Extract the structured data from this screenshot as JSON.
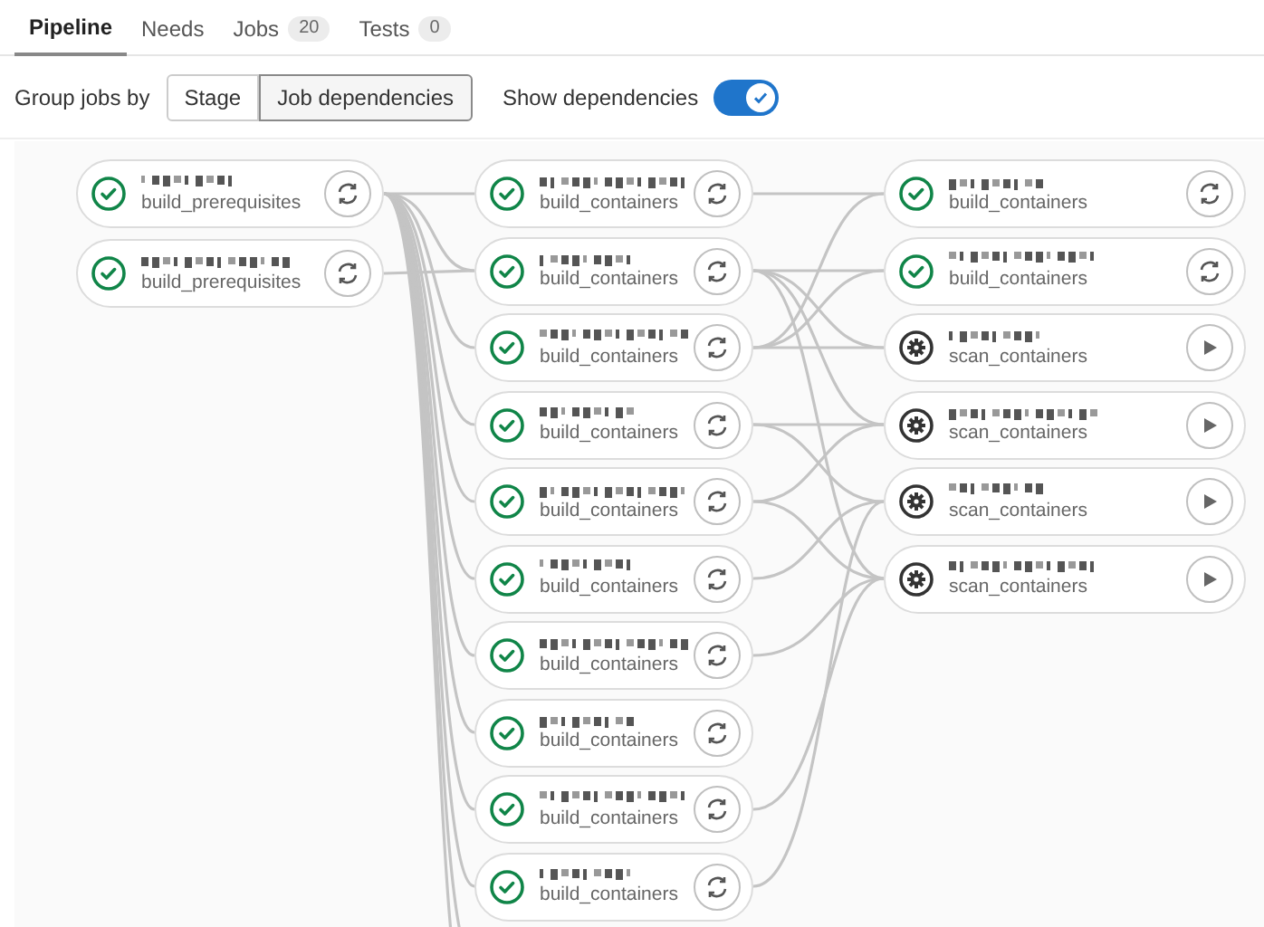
{
  "tabs": [
    {
      "label": "Pipeline",
      "selected": true
    },
    {
      "label": "Needs",
      "selected": false
    },
    {
      "label": "Jobs",
      "count": "20",
      "selected": false
    },
    {
      "label": "Tests",
      "count": "0",
      "selected": false
    }
  ],
  "toolbar": {
    "group_label": "Group jobs by",
    "group_options": [
      {
        "label": "Stage",
        "selected": false
      },
      {
        "label": "Job dependencies",
        "selected": true
      }
    ],
    "toggle_label": "Show dependencies",
    "toggle_on": true
  },
  "columns": [
    {
      "jobs": [
        {
          "stage": "build_prerequisites",
          "kind": "success"
        },
        {
          "stage": "build_prerequisites",
          "kind": "success"
        }
      ]
    },
    {
      "jobs": [
        {
          "stage": "build_containers",
          "kind": "success"
        },
        {
          "stage": "build_containers",
          "kind": "success"
        },
        {
          "stage": "build_containers",
          "kind": "success"
        },
        {
          "stage": "build_containers",
          "kind": "success"
        },
        {
          "stage": "build_containers",
          "kind": "success"
        },
        {
          "stage": "build_containers",
          "kind": "success"
        },
        {
          "stage": "build_containers",
          "kind": "success"
        },
        {
          "stage": "build_containers",
          "kind": "success"
        },
        {
          "stage": "build_containers",
          "kind": "success"
        },
        {
          "stage": "build_containers",
          "kind": "success"
        }
      ]
    },
    {
      "jobs": [
        {
          "stage": "build_containers",
          "kind": "success"
        },
        {
          "stage": "build_containers",
          "kind": "success"
        },
        {
          "stage": "scan_containers",
          "kind": "manual"
        },
        {
          "stage": "scan_containers",
          "kind": "manual"
        },
        {
          "stage": "scan_containers",
          "kind": "manual"
        },
        {
          "stage": "scan_containers",
          "kind": "manual"
        }
      ]
    }
  ]
}
